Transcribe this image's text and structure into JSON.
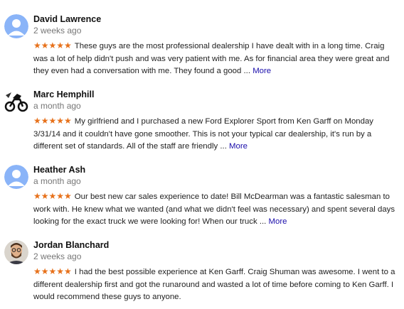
{
  "colors": {
    "star": "#e7711b",
    "link": "#1a0dab",
    "date": "#777777",
    "avatar_blue": "#8ab4f8"
  },
  "reviews": [
    {
      "avatar": "default-person-icon",
      "name": "David Lawrence",
      "date": "2 weeks ago",
      "stars": "★★★★★",
      "text": "These guys are the most professional dealership I have dealt with in a long time. Craig was a lot of help didn't push and was very patient with me. As for financial area they were great and they even had a conversation with me. They found a good",
      "more": "More"
    },
    {
      "avatar": "motorcycle-photo",
      "name": "Marc Hemphill",
      "date": "a month ago",
      "stars": "★★★★★",
      "text": "My girlfriend and I purchased a new Ford Explorer Sport from Ken Garff on Monday 3/31/14 and it couldn't have gone smoother. This is not your typical car dealership, it's run by a different set of standards. All of the staff are friendly",
      "more": "More"
    },
    {
      "avatar": "default-person-icon",
      "name": "Heather Ash",
      "date": "a month ago",
      "stars": "★★★★★",
      "text": "Our best new car sales experience to date! Bill McDearman was a fantastic salesman to work with. He knew what we wanted (and what we didn't feel was necessary) and spent several days looking for the exact truck we were looking for! When our truck",
      "more": "More"
    },
    {
      "avatar": "man-portrait-photo",
      "name": "Jordan Blanchard",
      "date": "2 weeks ago",
      "stars": "★★★★★",
      "text": "I had the best possible experience at Ken Garff. Craig Shuman was awesome. I went to a different dealership first and got the runaround and wasted a lot of time before coming to Ken Garff. I would recommend these guys to anyone."
    }
  ]
}
